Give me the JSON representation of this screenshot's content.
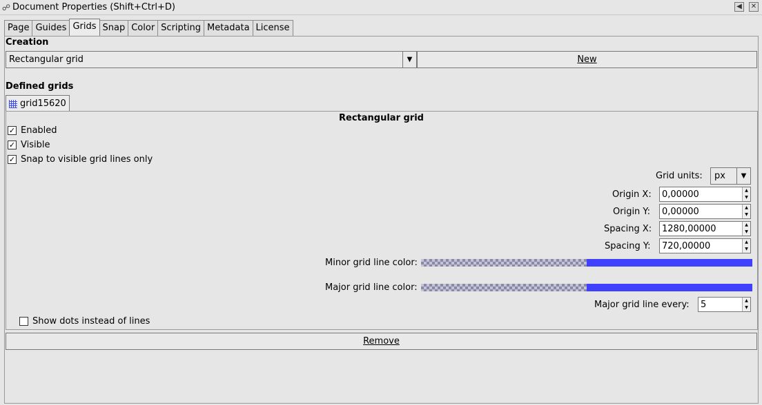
{
  "window": {
    "title": "Document Properties (Shift+Ctrl+D)",
    "icon": "app-icon",
    "controls": [
      "restore-icon",
      "close-icon"
    ]
  },
  "tabs": [
    {
      "label": "Page"
    },
    {
      "label": "Guides"
    },
    {
      "label": "Grids",
      "active": true
    },
    {
      "label": "Snap"
    },
    {
      "label": "Color"
    },
    {
      "label": "Scripting"
    },
    {
      "label": "Metadata"
    },
    {
      "label": "License"
    }
  ],
  "creation": {
    "heading": "Creation",
    "grid_type": "Rectangular grid",
    "new_label": "New"
  },
  "defined": {
    "heading": "Defined grids",
    "grid_tab": "grid15620"
  },
  "grid": {
    "heading": "Rectangular grid",
    "enabled": {
      "label": "Enabled",
      "checked": true
    },
    "visible": {
      "label": "Visible",
      "checked": true
    },
    "snap_visible": {
      "label": "Snap to visible grid lines only",
      "checked": true
    },
    "units_label": "Grid units:",
    "units_value": "px",
    "origin_x_label": "Origin X:",
    "origin_x": "0,00000",
    "origin_y_label": "Origin Y:",
    "origin_y": "0,00000",
    "spacing_x_label": "Spacing X:",
    "spacing_x": "1280,00000",
    "spacing_y_label": "Spacing Y:",
    "spacing_y": "720,00000",
    "minor_color_label": "Minor grid line color:",
    "major_color_label": "Major grid line color:",
    "grid_color": "#4040ff",
    "major_every_label": "Major grid line every:",
    "major_every": "5",
    "show_dots": {
      "label": "Show dots instead of lines",
      "checked": false
    }
  },
  "remove_label": "Remove"
}
